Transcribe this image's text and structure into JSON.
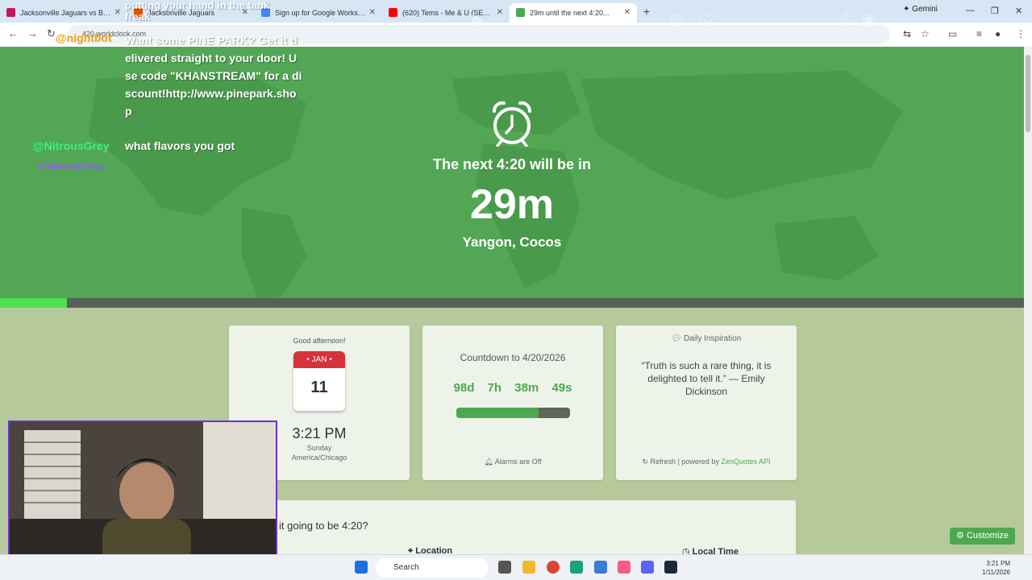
{
  "browser": {
    "tabs": [
      {
        "title": "Jacksonville Jaguars vs Buffalo",
        "color": "#c2185b"
      },
      {
        "title": "Jacksonville Jaguars",
        "color": "#e65100"
      },
      {
        "title": "Sign up for Google Workspace",
        "color": "#4285f4"
      },
      {
        "title": "(620) Tems - Me & U (SEV...",
        "color": "#ff0000"
      },
      {
        "title": "29m until the next 4:20...",
        "color": "#4ea852"
      }
    ],
    "gemini_label": "Gemini",
    "url": "420.worldclock.com"
  },
  "hero": {
    "subtitle": "The next 4:20 will be in",
    "countdown": "29m",
    "location": "Yangon, Cocos",
    "progress_fraction": 0.065
  },
  "overlay": {
    "chat": [
      {
        "user": "@nightbot",
        "user_color": "#e8a21a",
        "message": "Want some PINE PARK? Get it delivered straight to your door! Use code \"KHANSTREAM\" for a discount!http://www.pinepark.shop"
      },
      {
        "user": "@NitrousGrey",
        "user_color": "#3ff07a",
        "message": "what flavors you got"
      },
      {
        "user": "Violence4You",
        "user_color": "#9b59ff",
        "message": ""
      }
    ],
    "partial_message": "putting your hand in the tank freak"
  },
  "cards": {
    "greeting": "Good afternoon!",
    "month": "JAN",
    "day": "11",
    "time": "3:21 PM",
    "weekday": "Sunday",
    "timezone": "America/Chicago",
    "countdown_title": "Countdown to 4/20/2026",
    "cd_days": "98d",
    "cd_hours": "7h",
    "cd_minutes": "38m",
    "cd_seconds": "49s",
    "cd_progress_fraction": 0.73,
    "alarms": "Alarms are Off",
    "inspiration_title": "Daily Inspiration",
    "quote": "“Truth is such a rare thing, it is delighted to tell it.” — Emily Dickinson",
    "refresh": "Refresh",
    "powered_prefix": "| powered by",
    "powered_link": "ZenQuotes API"
  },
  "lower": {
    "question": "it going to be 4:20?",
    "col_location": "Location",
    "col_local_time": "Local Time"
  },
  "customize_label": "Customize",
  "taskbar": {
    "search": "Search",
    "time": "3:21 PM",
    "date": "1/11/2026"
  }
}
